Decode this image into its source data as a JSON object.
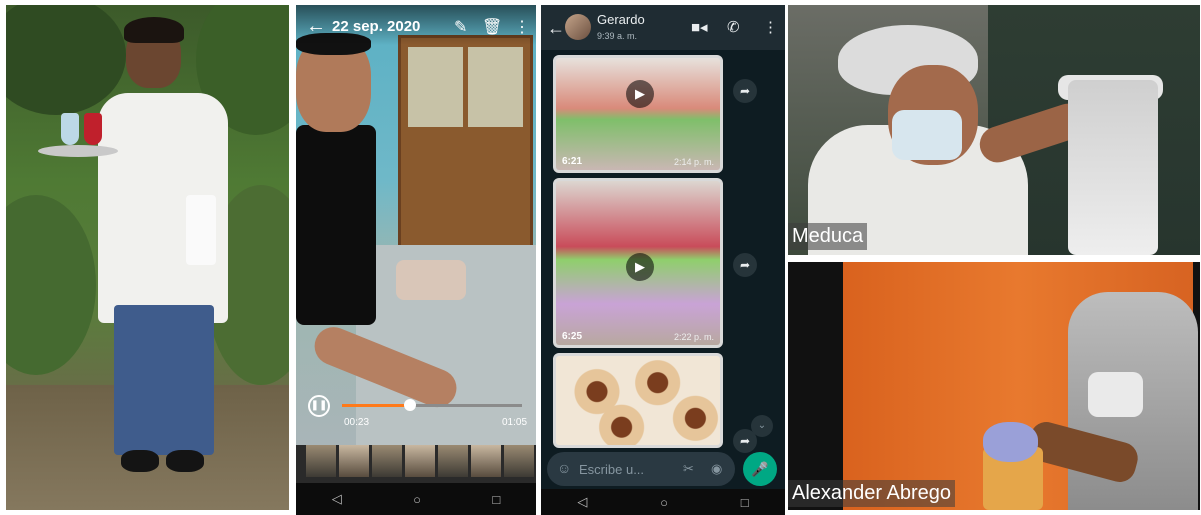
{
  "video_player": {
    "date": "22 sep. 2020",
    "time_current": "00:23",
    "time_total": "01:05",
    "progress": 0.38,
    "icons": [
      "back-arrow-icon",
      "edit-icon",
      "delete-icon",
      "more-vert-icon",
      "pause-icon"
    ],
    "nav": [
      "◁",
      "○",
      "□"
    ]
  },
  "chat": {
    "contact_name": "Gerardo",
    "status": "9:39 a. m.",
    "messages": [
      {
        "duration": "6:21",
        "time": "2:14 p. m.",
        "type": "video"
      },
      {
        "duration": "6:25",
        "time": "2:22 p. m.",
        "type": "video"
      },
      {
        "duration": "",
        "time": "",
        "type": "image"
      }
    ],
    "input_placeholder": "Escribe u...",
    "icons": [
      "back-arrow-icon",
      "video-call-icon",
      "phone-icon",
      "more-vert-icon",
      "emoji-icon",
      "attach-icon",
      "camera-icon",
      "mic-icon",
      "forward-icon"
    ],
    "nav": [
      "◁",
      "○",
      "□"
    ]
  },
  "call": {
    "participant_1": "Meduca",
    "participant_2": "Alexander Abrego"
  }
}
